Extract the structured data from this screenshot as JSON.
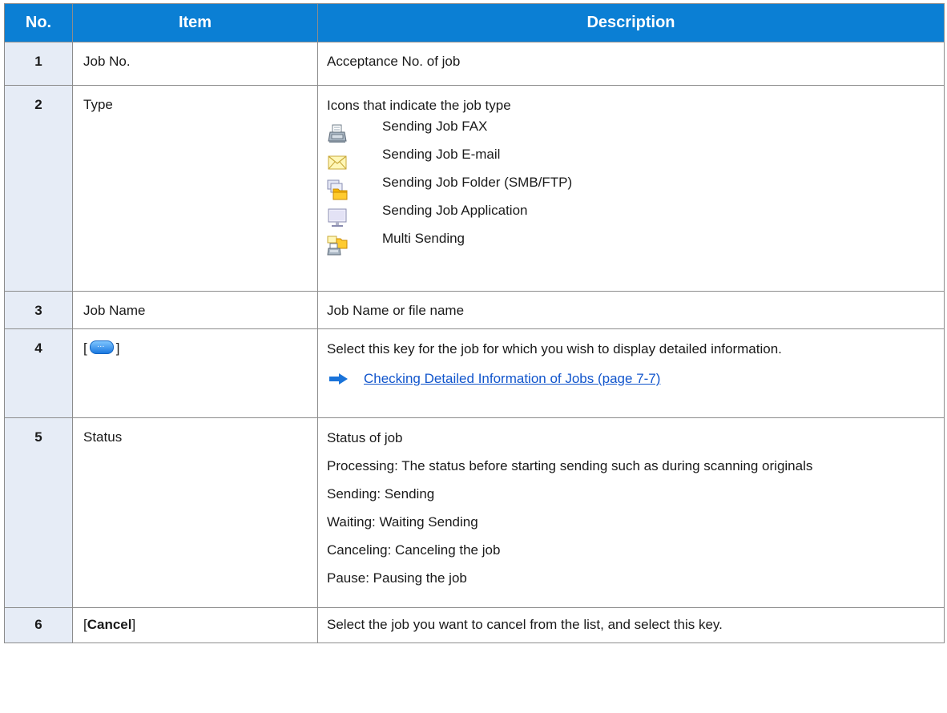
{
  "table": {
    "headers": {
      "no": "No.",
      "item": "Item",
      "description": "Description"
    },
    "rows": [
      {
        "no": "1",
        "item": "Job No.",
        "desc": "Acceptance No. of job"
      },
      {
        "no": "2",
        "item": "Type",
        "desc": "Icons that indicate the job type",
        "types": [
          {
            "icon": "fax-icon",
            "label": "Sending Job FAX"
          },
          {
            "icon": "email-icon",
            "label": "Sending Job E-mail"
          },
          {
            "icon": "folder-icon",
            "label": "Sending Job Folder (SMB/FTP)"
          },
          {
            "icon": "monitor-icon",
            "label": "Sending Job Application"
          },
          {
            "icon": "multi-send-icon",
            "label": "Multi Sending"
          }
        ]
      },
      {
        "no": "3",
        "item": "Job Name",
        "desc": "Job Name or file name"
      },
      {
        "no": "4",
        "item_open": "[",
        "item_close": "]",
        "desc": "Select this key for the job for which you wish to display detailed information.",
        "link": "Checking Detailed Information of Jobs (page 7-7)"
      },
      {
        "no": "5",
        "item": "Status",
        "desc_lines": [
          "Status of job",
          "Processing: The status before starting sending such as during scanning originals",
          "Sending: Sending",
          "Waiting: Waiting Sending",
          "Canceling: Canceling the job",
          "Pause: Pausing the job"
        ]
      },
      {
        "no": "6",
        "item_open": "[",
        "item_key": "Cancel",
        "item_close": "]",
        "desc": "Select the job you want to cancel from the list, and select this key."
      }
    ]
  },
  "colors": {
    "header_bg": "#0b7fd4",
    "number_cell_bg": "#e6ecf6",
    "link": "#1155cc",
    "arrow": "#1a73d9"
  }
}
